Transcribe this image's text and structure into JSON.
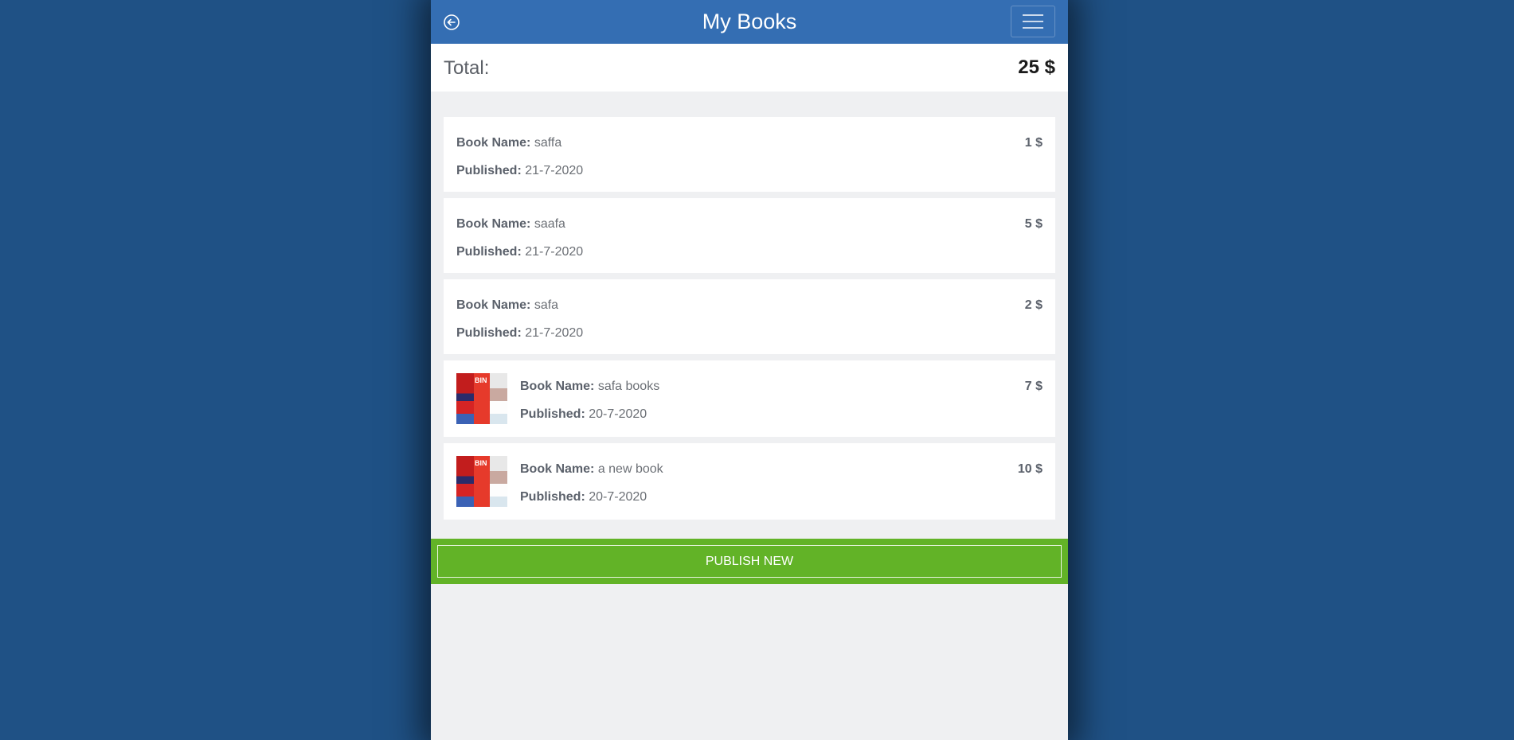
{
  "header": {
    "title": "My Books",
    "back_icon": "back-circle-icon",
    "menu_icon": "hamburger-menu-icon"
  },
  "total": {
    "label": "Total:",
    "value": "25 $"
  },
  "labels": {
    "book_name": "Book Name:",
    "published": "Published:"
  },
  "books": [
    {
      "name": "saffa",
      "published": "21-7-2020",
      "price": "1 $"
    },
    {
      "name": "saafa",
      "published": "21-7-2020",
      "price": "5 $"
    },
    {
      "name": "safa",
      "published": "21-7-2020",
      "price": "2 $"
    },
    {
      "name": "safa books",
      "published": "20-7-2020",
      "price": "7 $"
    },
    {
      "name": "a new book",
      "published": "20-7-2020",
      "price": "10 $"
    }
  ],
  "publish_button": "PUBLISH NEW",
  "colors": {
    "page_bg": "#1f5185",
    "header": "#346eb3",
    "publish": "#62b327"
  }
}
